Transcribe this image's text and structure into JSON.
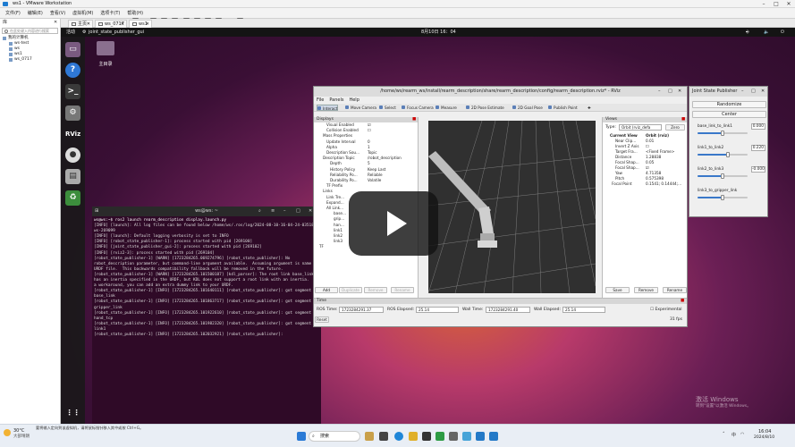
{
  "vmware": {
    "title": "ws1 - VMware Workstation",
    "menu": [
      "文件(F)",
      "编辑(E)",
      "查看(V)",
      "虚拟机(M)",
      "选项卡(T)",
      "帮助(H)"
    ],
    "tabs": [
      {
        "label": "主页"
      },
      {
        "label": "ws_0717"
      },
      {
        "label": "ws1"
      }
    ],
    "library": {
      "title": "库",
      "search_placeholder": "在此处键入内容进行搜索",
      "tree": [
        "我的计算机",
        "ws-test",
        "ws",
        "ws1",
        "ws_0717"
      ]
    }
  },
  "ubuntu": {
    "activities": "活动",
    "app_name": "joint_state_publisher_gui",
    "clock": "8月10日 16：04",
    "home_folder": "主目录"
  },
  "terminal": {
    "title": "ws@ws: ~",
    "lines": [
      "ws@ws:~$ ros2 launch rearm_description display.launch.py",
      "[INFO] [launch]: All log files can be found below /home/ws/.ros/log/2024-08-10-16-04-24-035186-ws-269099",
      "[INFO] [launch]: Default logging verbosity is set to INFO",
      "[INFO] [robot_state_publisher-1]: process started with pid [269100]",
      "[INFO] [joint_state_publisher_gui-2]: process started with pid [269102]",
      "[INFO] [rviz2-3]: process started with pid [269104]",
      "[robot_state_publisher-1] [WARN] [1723284265.069274796] [robot_state_publisher]: No robot_description parameter, but command-line argument available.  Assuming argument is name of URDF file.  This backwards compatibility fallback will be removed in the future.",
      "[robot_state_publisher-1] [WARN] [1723284265.101500187] [kdl_parser]: The root link base_link has an inertia specified in the URDF, but KDL does not support a root link with an inertia.  As a workaround, you can add an extra dummy link to your URDF.",
      "[robot_state_publisher-1] [INFO] [1723284265.101640111] [robot_state_publisher]: got segment base_link",
      "[robot_state_publisher-1] [INFO] [1723284265.101863717] [robot_state_publisher]: got segment gripper_link",
      "[robot_state_publisher-1] [INFO] [1723284265.101922610] [robot_state_publisher]: got segment hand_tcp",
      "[robot_state_publisher-1] [INFO] [1723284265.101982320] [robot_state_publisher]: got segment link1",
      "[robot_state_publisher-1] [INFO] [1723284265.102032921] [robot_state_publisher]:"
    ]
  },
  "rviz": {
    "title": "/home/ws/rearm_ws/install/rearm_description/share/rearm_description/config/rearm_description.rviz* - RViz",
    "menu": [
      "File",
      "Panels",
      "Help"
    ],
    "tools": [
      "Interact",
      "Move Camera",
      "Select",
      "Focus Camera",
      "Measure",
      "2D Pose Estimate",
      "2D Goal Pose",
      "Publish Point"
    ],
    "displays": {
      "header": "Displays",
      "rows": [
        {
          "k": "Visual Enabled",
          "v": "☑"
        },
        {
          "k": "Collision Enabled",
          "v": "☐"
        },
        {
          "k": "Mass Properties",
          "v": ""
        },
        {
          "k": "Update Interval",
          "v": "0"
        },
        {
          "k": "Alpha",
          "v": "1"
        },
        {
          "k": "Description Sou...",
          "v": "Topic"
        },
        {
          "k": "Description Topic",
          "v": "/robot_description"
        },
        {
          "k": "Depth",
          "v": "5"
        },
        {
          "k": "History Policy",
          "v": "Keep Last"
        },
        {
          "k": "Reliability Po...",
          "v": "Reliable"
        },
        {
          "k": "Durability Po...",
          "v": "Volatile"
        },
        {
          "k": "TF Prefix",
          "v": ""
        },
        {
          "k": "Links",
          "v": ""
        },
        {
          "k": "Link Tre...",
          "v": ""
        },
        {
          "k": "Expand...",
          "v": ""
        },
        {
          "k": "All Link...",
          "v": ""
        },
        {
          "k": "base...",
          "v": ""
        },
        {
          "k": "grip...",
          "v": ""
        },
        {
          "k": "han...",
          "v": ""
        },
        {
          "k": "link1",
          "v": ""
        },
        {
          "k": "link2",
          "v": ""
        },
        {
          "k": "link3",
          "v": ""
        },
        {
          "k": "TF",
          "v": ""
        }
      ],
      "buttons": [
        "Add",
        "Duplicate",
        "Remove",
        "Rename"
      ]
    },
    "views": {
      "header": "Views",
      "type_label": "Type:",
      "type_value": "Orbit (rviz_defa",
      "zero_label": "Zero",
      "rows": [
        {
          "k": "Current View",
          "v": "Orbit (rviz)"
        },
        {
          "k": "Near Clip...",
          "v": "0.01"
        },
        {
          "k": "Invert Z Axis",
          "v": "☐"
        },
        {
          "k": "Target Fra...",
          "v": "<Fixed Frame>"
        },
        {
          "k": "Distance",
          "v": "1.28838"
        },
        {
          "k": "Focal Shap...",
          "v": "0.05"
        },
        {
          "k": "Focal Shap...",
          "v": "☑"
        },
        {
          "k": "Yaw",
          "v": "4.71358"
        },
        {
          "k": "Pitch",
          "v": "0.575398"
        },
        {
          "k": "Focal Point",
          "v": "0.1541; 0.14444;..."
        }
      ],
      "buttons": [
        "Save",
        "Remove",
        "Rename"
      ]
    },
    "time": {
      "header": "Time",
      "ros_time_label": "ROS Time:",
      "ros_time": "1723284291.37",
      "ros_elapsed_label": "ROS Elapsed:",
      "ros_elapsed": "25.14",
      "wall_time_label": "Wall Time:",
      "wall_time": "1723284291.40",
      "wall_elapsed_label": "Wall Elapsed:",
      "wall_elapsed": "25.14",
      "experimental": "Experimental",
      "reset": "Reset",
      "fps": "31 fps"
    }
  },
  "jsp": {
    "title": "Joint State Publisher",
    "randomize": "Randomize",
    "center": "Center",
    "joints": [
      {
        "name": "base_link_to_link1",
        "value": "0.000",
        "level": 0.5
      },
      {
        "name": "link1_to_link2",
        "value": "0.220",
        "level": 0.6
      },
      {
        "name": "link2_to_link3",
        "value": "-0.000",
        "level": 0.5
      },
      {
        "name": "link3_to_gripper_link",
        "value": "",
        "level": 0.5
      }
    ]
  },
  "watermark": {
    "line1": "激活 Windows",
    "line2": "转到\"设置\"以激活 Windows。"
  },
  "taskbar": {
    "weather_temp": "30°C",
    "weather_desc": "大部晴朗",
    "hint": "要将输入定向到该虚拟机，请将鼠标指针移入其中或按 Ctrl+G。",
    "search": "搜索",
    "lang": "中",
    "time": "16:04",
    "date": "2024/8/10"
  }
}
